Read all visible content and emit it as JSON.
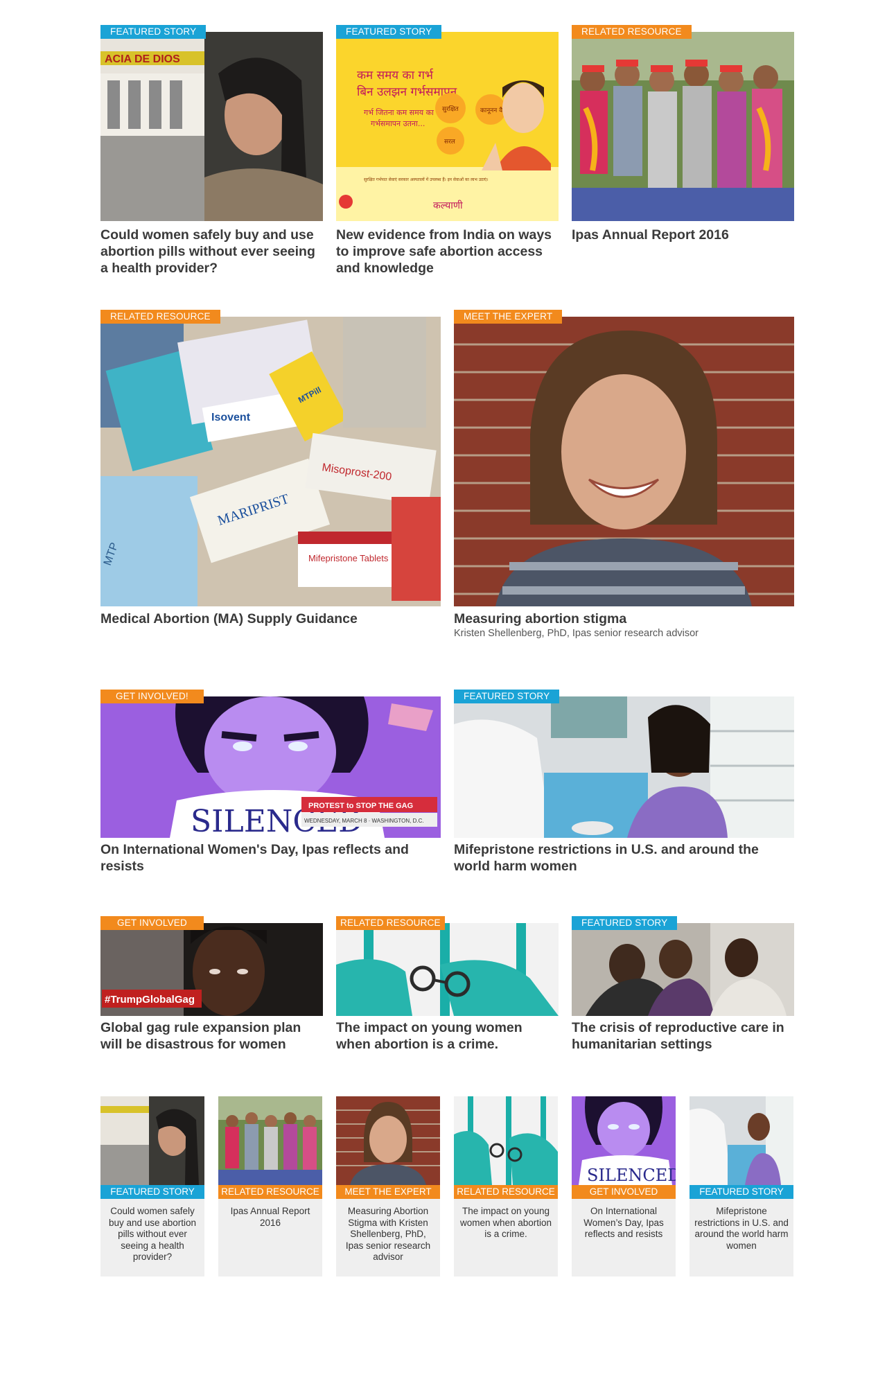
{
  "colors": {
    "featured": "#1aa3d6",
    "resource": "#f28a1d",
    "text": "#3a3a3a"
  },
  "row1": [
    {
      "tag": "Featured Story",
      "title": "Could women safely buy and use abortion pills without ever seeing a health provider?",
      "image": "woman-pharmacy-photo",
      "sign": "ACIA DE DIOS"
    },
    {
      "tag": "Featured Story",
      "title": "New evidence from India on ways to improve safe abortion access and knowledge",
      "image": "india-poster-illustration",
      "poster": {
        "line1": "कम समय का गर्भ",
        "line2": "बिन उलझन गर्भसमापन",
        "line3": "गर्भ जितना कम समय का",
        "line4": "गर्भसमापन उतना...",
        "b1": "सुरक्षित",
        "b2": "कानूनन वैध",
        "b3": "सरल",
        "brand": "कल्याणी",
        "note": "सुरक्षित गर्भपात सेवाएं सरकार अस्पतालों में उपलब्ध हैं। इन सेवाओं का लाभ उठाएं।"
      }
    },
    {
      "tag": "Related Resource",
      "title": "Ipas Annual Report 2016",
      "image": "group-of-young-women-photo"
    }
  ],
  "row2": [
    {
      "tag": "Related Resource",
      "title": "Medical Abortion (MA) Supply Guidance",
      "image": "medication-boxes-photo",
      "labels": {
        "a": "MARIPRIST",
        "b": "Misoprost-200",
        "c": "Mifepristone Tablets",
        "d": "Isovent",
        "e": "MTPill",
        "f": "MTP"
      }
    },
    {
      "tag": "Meet the Expert",
      "title": "Measuring abortion stigma",
      "subtitle": "Kristen Shellenberg, PhD, Ipas senior research advisor",
      "image": "portrait-woman-brick-wall-photo"
    }
  ],
  "row3": [
    {
      "tag": "Get Involved!",
      "title": "On International Women's Day, Ipas reflects and resists",
      "image": "silenced-poster",
      "poster": {
        "word": "SILENCED",
        "cta": "PROTEST to STOP THE GAG",
        "when": "WEDNESDAY, MARCH 8 · WASHINGTON, D.C."
      }
    },
    {
      "tag": "Featured Story",
      "title": "Mifepristone restrictions in U.S. and around the world harm women",
      "image": "pharmacy-counter-photo"
    }
  ],
  "row4": [
    {
      "tag": "Get Involved",
      "title": "Global gag rule expansion plan will be disastrous for women",
      "image": "trump-global-gag-photo",
      "hashtag": "#TrumpGlobalGag"
    },
    {
      "tag": "Related Resource",
      "title": "The impact on young women when abortion is a crime.",
      "image": "handcuffs-illustration"
    },
    {
      "tag": "Featured Story",
      "title": "The crisis of reproductive care in humanitarian settings",
      "image": "women-in-discussion-photo"
    }
  ],
  "mini": [
    {
      "tag": "Featured Story",
      "title": "Could women safely buy and use abortion pills without ever seeing a health provider?",
      "image": "woman-pharmacy-photo"
    },
    {
      "tag": "Related Resource",
      "title": "Ipas Annual Report 2016",
      "image": "group-of-young-women-photo"
    },
    {
      "tag": "Meet the Expert",
      "title": "Measuring Abortion Stigma with Kristen Shellenberg, PhD, Ipas senior research advisor",
      "image": "portrait-woman-brick-wall-photo"
    },
    {
      "tag": "Related Resource",
      "title": "The impact on young women when abortion is a crime.",
      "image": "handcuffs-illustration"
    },
    {
      "tag": "Get Involved",
      "title": "On International Women’s Day, Ipas reflects and resists",
      "image": "silenced-poster"
    },
    {
      "tag": "Featured Story",
      "title": "Mifepristone restrictions in U.S. and around the world harm women",
      "image": "pharmacy-counter-photo"
    }
  ]
}
